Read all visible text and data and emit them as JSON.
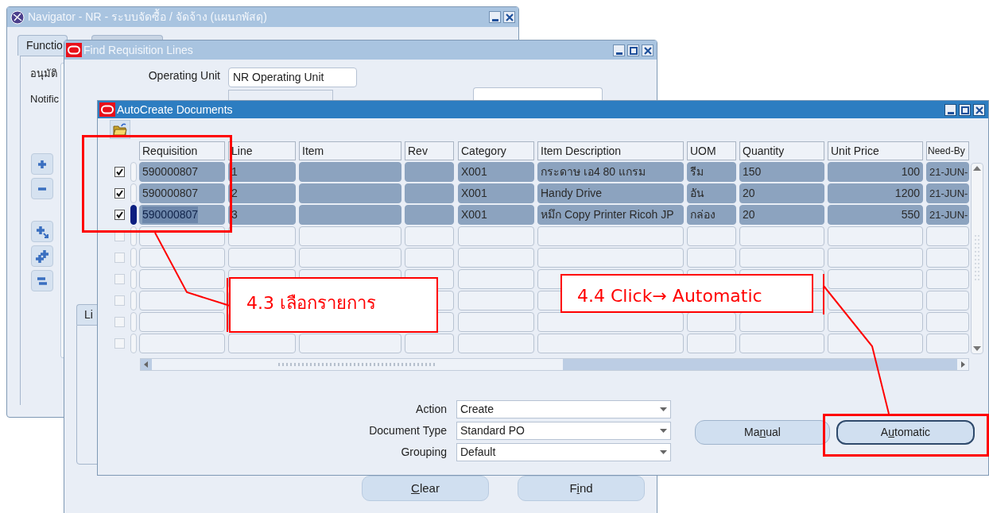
{
  "navigator": {
    "title": "Navigator - NR - ระบบจัดซื้อ / จัดจ้าง (แผนกพัสดุ)",
    "tabs": [
      {
        "label": "Functio",
        "selected": true
      },
      {
        "selected": false
      }
    ],
    "items": [
      "อนุมัติ",
      "Notific"
    ]
  },
  "find_window": {
    "title": "Find Requisition Lines",
    "fields": [
      {
        "label": "Operating Unit",
        "value": "NR Operating Unit",
        "kind": "text"
      },
      {
        "kind": "dropdown"
      }
    ],
    "tab": {
      "label": "Li"
    },
    "buttons": [
      {
        "key": "C",
        "post": "lear"
      },
      {
        "pre": "F",
        "key": "i",
        "post": "nd"
      }
    ]
  },
  "autocreate": {
    "title": "AutoCreate Documents",
    "columns": [
      "Requisition",
      "Line",
      "Item",
      "Rev",
      "Category",
      "Item Description",
      "UOM",
      "Quantity",
      "Unit Price",
      "Need-By"
    ],
    "rows": [
      {
        "checked": true,
        "selected": true,
        "current": false,
        "cells": [
          "590000807",
          "1",
          "",
          "",
          "X001",
          "กระดาษ เอ4 80 แกรม",
          "รีม",
          "150",
          "100",
          "21-JUN-"
        ]
      },
      {
        "checked": true,
        "selected": true,
        "current": false,
        "cells": [
          "590000807",
          "2",
          "",
          "",
          "X001",
          "Handy Drive",
          "อัน",
          "20",
          "1200",
          "21-JUN-"
        ]
      },
      {
        "checked": true,
        "selected": true,
        "current": true,
        "cells": [
          "590000807",
          "3",
          "",
          "",
          "X001",
          "หมึก Copy Printer Ricoh JP",
          "กล่อง",
          "20",
          "550",
          "21-JUN-"
        ]
      },
      {
        "checked": false,
        "selected": false,
        "current": false
      },
      {
        "checked": false,
        "selected": false,
        "current": false
      },
      {
        "checked": false,
        "selected": false,
        "current": false
      },
      {
        "checked": false,
        "selected": false,
        "current": false
      },
      {
        "checked": false,
        "selected": false,
        "current": false
      },
      {
        "checked": false,
        "selected": false,
        "current": false
      }
    ],
    "options": [
      {
        "label": "Action",
        "value": "Create"
      },
      {
        "label": "Document Type",
        "value": "Standard PO"
      },
      {
        "label": "Grouping",
        "value": "Default"
      }
    ],
    "buttons": [
      {
        "pre": "Ma",
        "key": "n",
        "post": "ual",
        "highlighted": false
      },
      {
        "pre": "A",
        "key": "u",
        "post": "tomatic",
        "highlighted": true
      }
    ]
  },
  "annotations": [
    {
      "text": "4.3 เลือกรายการ"
    },
    {
      "text": "4.4 Click→ Automatic"
    }
  ]
}
